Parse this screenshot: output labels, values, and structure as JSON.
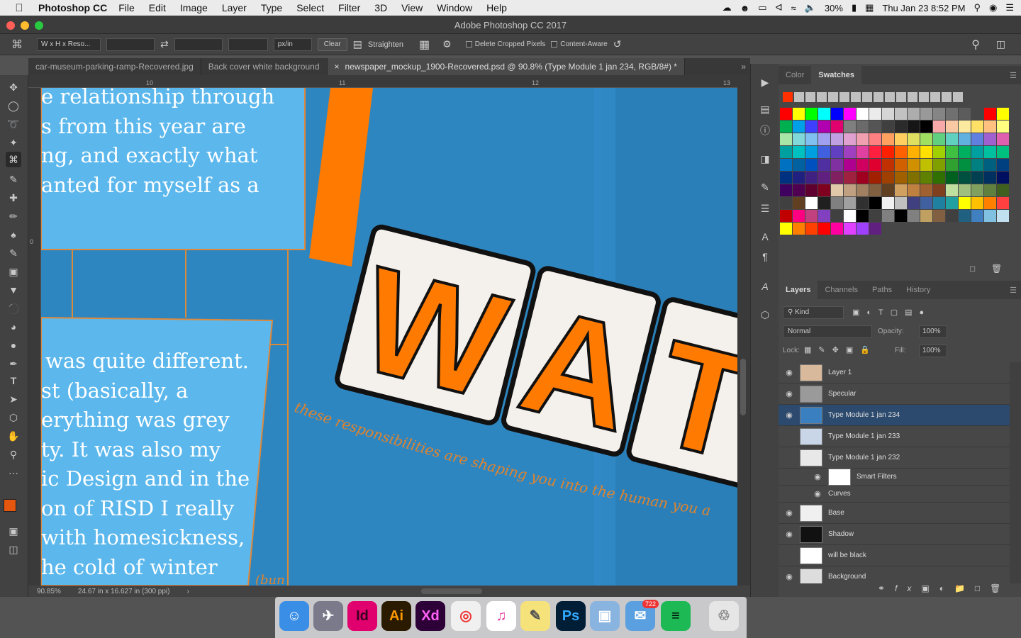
{
  "menubar": {
    "app": "Photoshop CC",
    "items": [
      "File",
      "Edit",
      "Image",
      "Layer",
      "Type",
      "Select",
      "Filter",
      "3D",
      "View",
      "Window",
      "Help"
    ],
    "battery": "30%",
    "datetime": "Thu Jan 23  8:52 PM"
  },
  "window_title": "Adobe Photoshop CC 2017",
  "options": {
    "ratio": "W x H x Reso...",
    "units": "px/in",
    "clear": "Clear",
    "straighten": "Straighten",
    "delete_cropped": "Delete Cropped Pixels",
    "content_aware": "Content-Aware"
  },
  "tabs": [
    "car-museum-parking-ramp-Recovered.jpg",
    "Back cover white background",
    "newspaper_mockup_1900-Recovered.psd @ 90.8% (Type Module 1 jan 234, RGB/8#) *"
  ],
  "ruler": {
    "marks": [
      "10",
      "11",
      "12",
      "13"
    ],
    "left_mark": "0"
  },
  "canvas": {
    "lines_top": [
      "e relationship through",
      "s from this year are",
      "ng, and exactly what",
      "anted for myself as a"
    ],
    "lines_bottom": [
      "was quite different.",
      "st (basically, a",
      "erything was grey",
      "ty. It was also my",
      "ic Design and in the",
      "on of RISD I really",
      "with homesickness,",
      "he cold of winter"
    ],
    "tile_letters": [
      "W",
      "A",
      "T"
    ],
    "curved_text": "these responsibilities are shaping you into the human you a",
    "fragment": "(bun"
  },
  "status": {
    "zoom": "90.85%",
    "doc": "24.67 in x 16.627 in (300 ppi)"
  },
  "color_panel": {
    "tabs": [
      "Color",
      "Swatches"
    ]
  },
  "layers_panel": {
    "tabs": [
      "Layers",
      "Channels",
      "Paths",
      "History"
    ],
    "kind": "Kind",
    "blend": "Normal",
    "opacity_label": "Opacity:",
    "opacity": "100%",
    "lock_label": "Lock:",
    "fill_label": "Fill:",
    "fill": "100%",
    "layers": [
      {
        "name": "Layer 1",
        "visible": true
      },
      {
        "name": "Specular",
        "visible": true
      },
      {
        "name": "Type Module 1 jan 234",
        "visible": true,
        "selected": true
      },
      {
        "name": "Type Module 1 jan 233",
        "visible": false
      },
      {
        "name": "Type Module 1 jan 232",
        "visible": false
      },
      {
        "name": "Smart Filters",
        "visible": true,
        "sub": true
      },
      {
        "name": "Curves",
        "visible": true,
        "sub": true
      },
      {
        "name": "Base",
        "visible": true
      },
      {
        "name": "Shadow",
        "visible": true
      },
      {
        "name": "will be black",
        "visible": false
      },
      {
        "name": "Background",
        "visible": true
      }
    ]
  },
  "dock": {
    "apps": [
      "Finder",
      "Launchpad",
      "Id",
      "Ai",
      "Xd",
      "Chrome",
      "iTunes",
      "Stickies",
      "Ps",
      "Preview",
      "Mail",
      "Spotify",
      "Trash"
    ],
    "mail_badge": "722"
  },
  "colors": {
    "accent": "#ff7a00",
    "canvas": "#2e86c0",
    "panel": "#4a90d2",
    "selected": "#2c4a6e"
  }
}
